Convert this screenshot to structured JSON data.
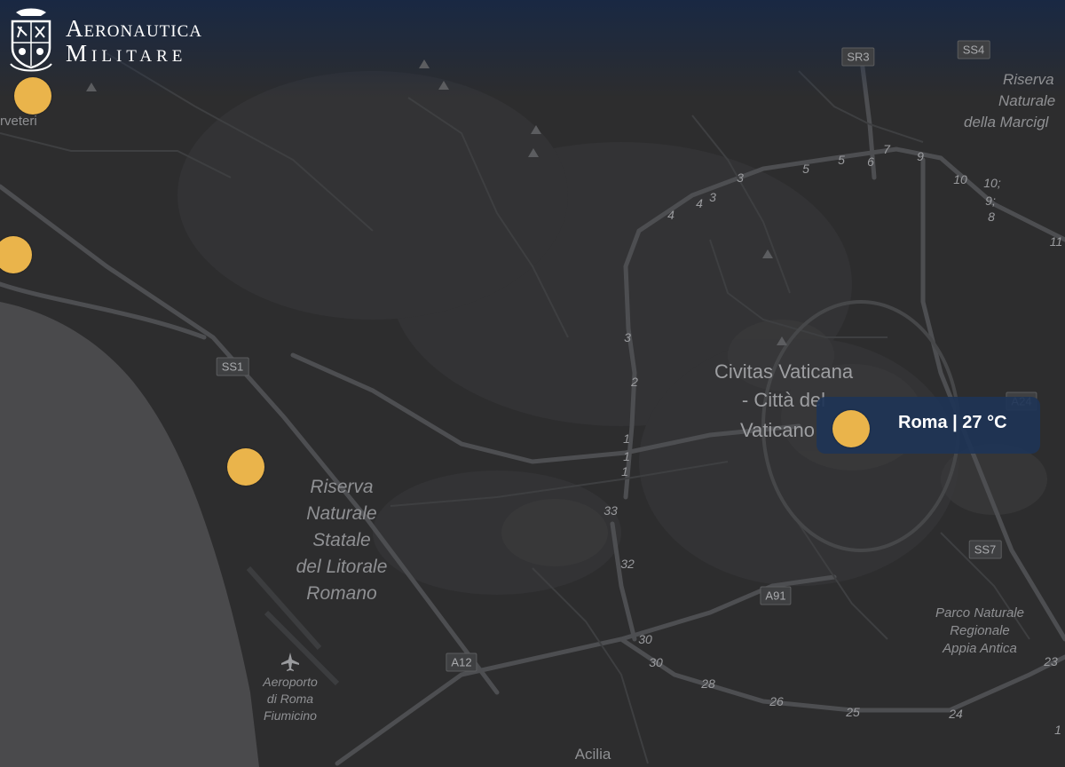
{
  "brand": {
    "line1": "Aeronautica",
    "line2": "Militare",
    "emblem": "coat-of-arms-icon"
  },
  "places": {
    "cerveteri": "rveteri",
    "vatican_1": "Civitas Vaticana",
    "vatican_2": "- Città del",
    "vatican_3": "Vaticano",
    "reserve_1": "Riserva",
    "reserve_2": "Naturale",
    "reserve_3": "Statale",
    "reserve_4": "del Litorale",
    "reserve_5": "Romano",
    "marcig_1": "Riserva",
    "marcig_2": "Naturale",
    "marcig_3": "della Marcigl",
    "appia_1": "Parco Naturale",
    "appia_2": "Regionale",
    "appia_3": "Appia Antica",
    "airport_1": "Aeroporto",
    "airport_2": "di Roma",
    "airport_3": "Fiumicino",
    "acilia": "Acilia"
  },
  "roads": {
    "ss1": "SS1",
    "a12": "A12",
    "a91": "A91",
    "ss7": "SS7",
    "sr3": "SR3",
    "ss4": "SS4",
    "a24": "A24"
  },
  "road_numbers": {
    "n3a": "3",
    "n4a": "4",
    "n4b": "4",
    "n3b": "3",
    "n3c": "3",
    "n5a": "5",
    "n5b": "5",
    "n6": "6",
    "n7": "7",
    "n9": "9",
    "n10a": "10",
    "n10b": "10;",
    "n9b": "9;",
    "n8": "8",
    "n11": "11",
    "n3d": "3",
    "n2": "2",
    "n1a": "1",
    "n1b": "1",
    "n1c": "1",
    "n33": "33",
    "n32": "32",
    "n30a": "30",
    "n30b": "30",
    "n28": "28",
    "n26": "26",
    "n25": "25",
    "n24": "24",
    "n23": "23",
    "n1d": "1"
  },
  "tooltip": {
    "text": "Roma | 27 °C"
  },
  "colors": {
    "station": "#eab44b",
    "tooltip_bg": "#1e3456",
    "sea": "#4a4a4c",
    "land": "#2d2d2e",
    "road": "#4d4e51"
  },
  "icons": {
    "airport": "airplane-icon",
    "peak": "mountain-peak-icon"
  }
}
